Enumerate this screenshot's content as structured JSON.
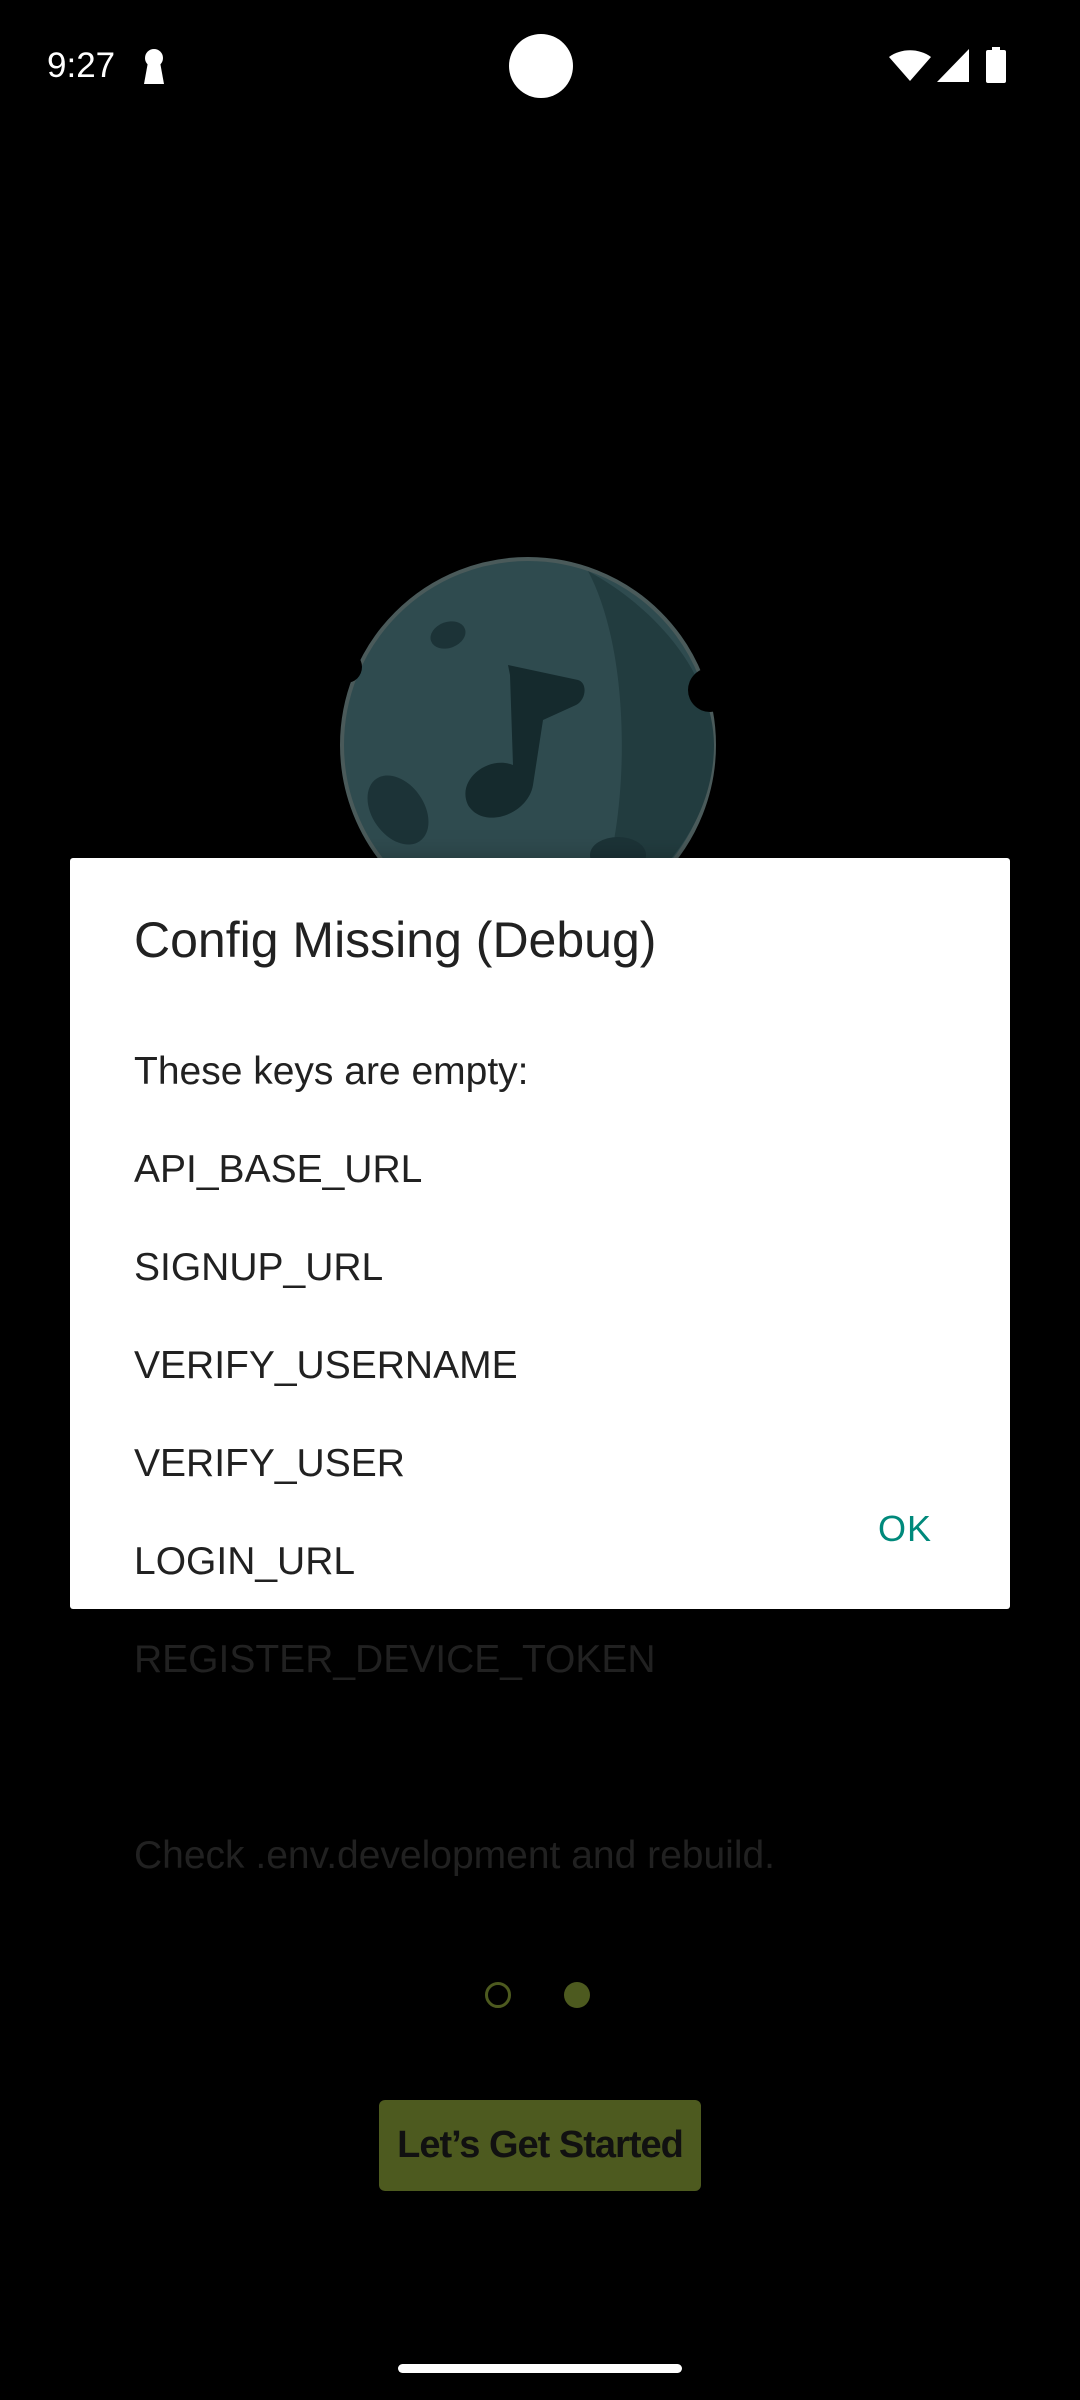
{
  "status_bar": {
    "time": "9:27"
  },
  "onboarding": {
    "illustration_icon": "moon-music-note-icon",
    "start_button_label": "Let’s Get Started",
    "pager": {
      "count": 2,
      "active_index": 1
    }
  },
  "dialog": {
    "title": "Config Missing (Debug)",
    "intro": "These keys are empty:",
    "keys": [
      "API_BASE_URL",
      "SIGNUP_URL",
      "VERIFY_USERNAME",
      "VERIFY_USER",
      "LOGIN_URL",
      "REGISTER_DEVICE_TOKEN"
    ],
    "footer": "Check .env.development and rebuild.",
    "ok_label": "OK"
  },
  "colors": {
    "background": "#000000",
    "accent_olive": "#4d5a1f",
    "dialog_button": "#00897b",
    "moon": "#2f4b4f"
  }
}
